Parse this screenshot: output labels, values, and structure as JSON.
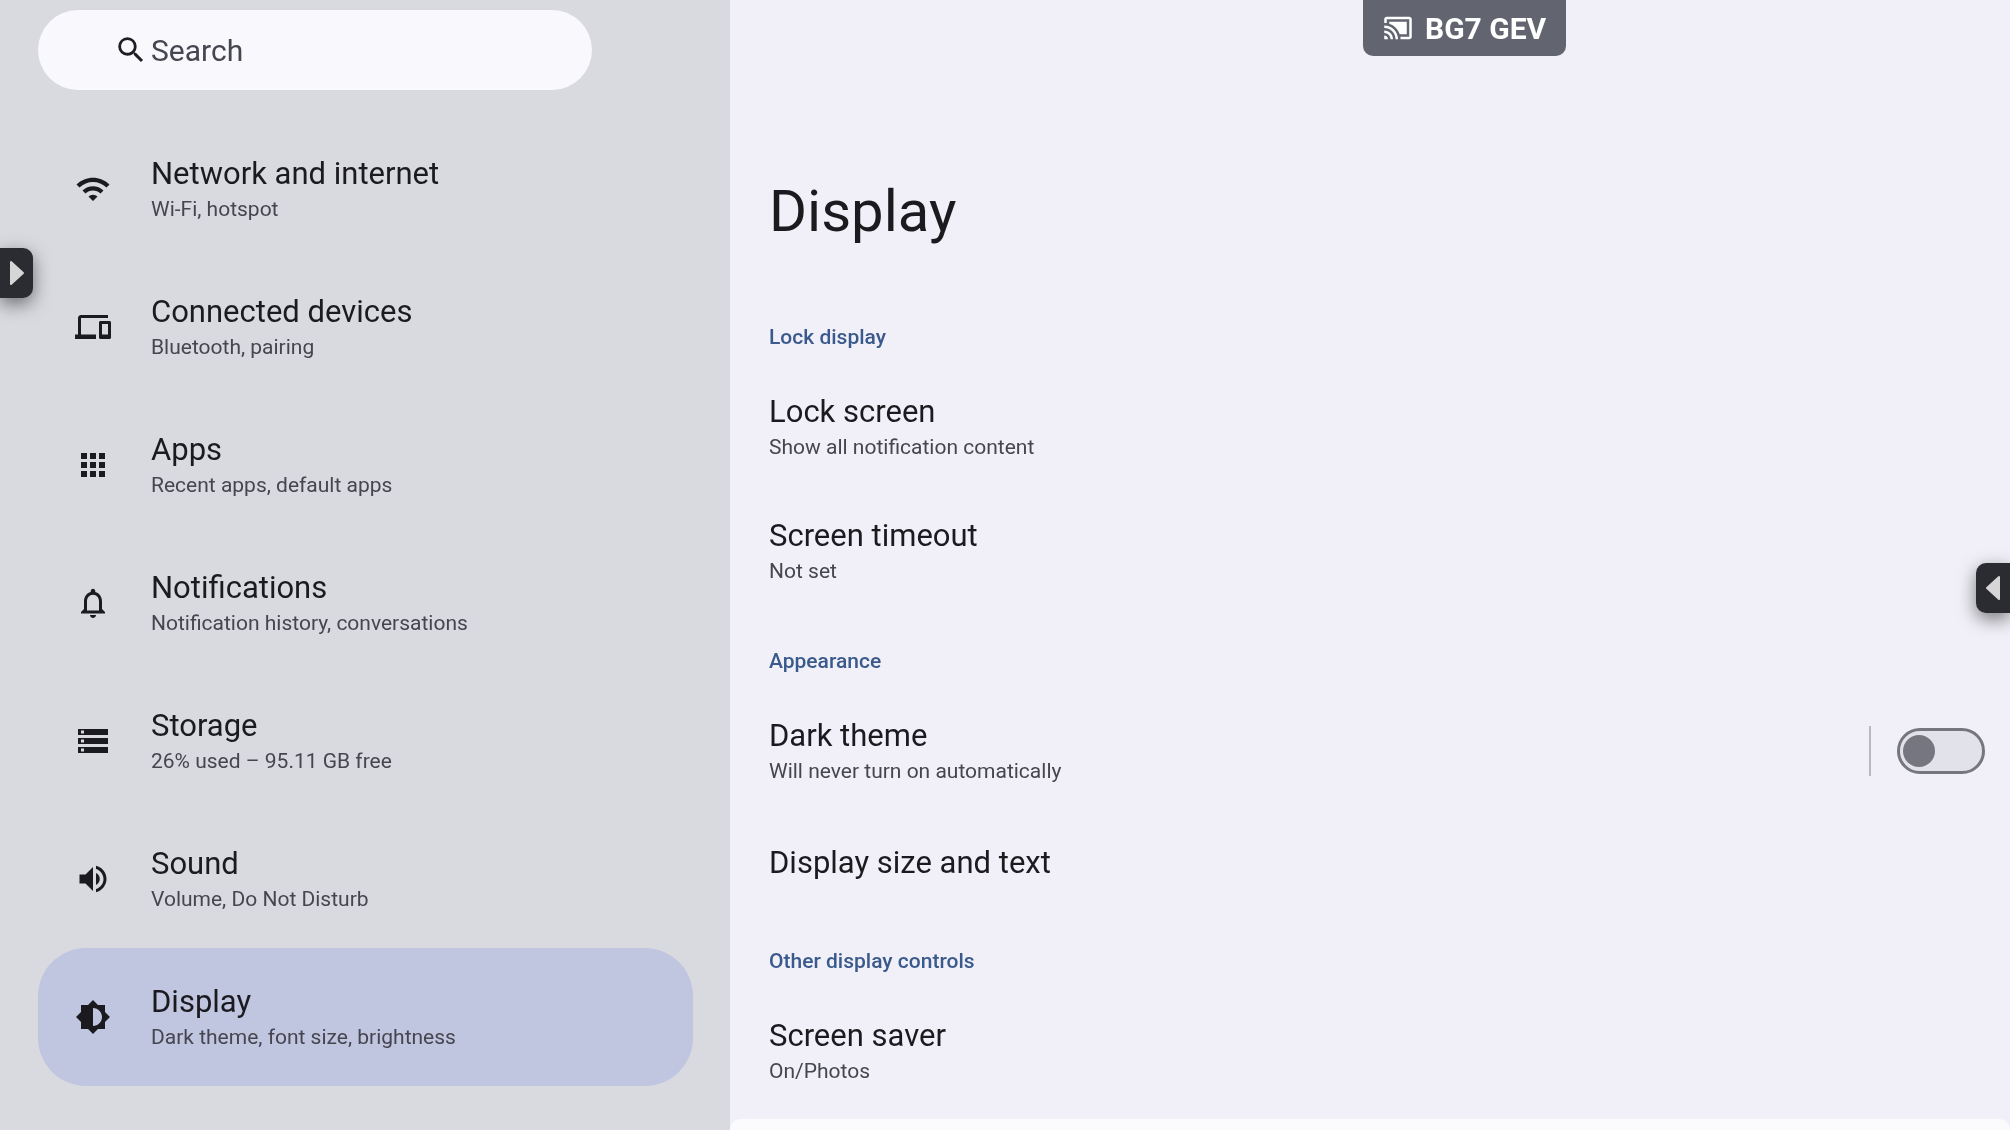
{
  "search": {
    "placeholder": "Search"
  },
  "sidebar": {
    "items": [
      {
        "title": "Network and internet",
        "subtitle": "Wi-Fi, hotspot",
        "selected": false
      },
      {
        "title": "Connected devices",
        "subtitle": "Bluetooth, pairing",
        "selected": false
      },
      {
        "title": "Apps",
        "subtitle": "Recent apps, default apps",
        "selected": false
      },
      {
        "title": "Notifications",
        "subtitle": "Notification history, conversations",
        "selected": false
      },
      {
        "title": "Storage",
        "subtitle": "26% used – 95.11 GB free",
        "selected": false
      },
      {
        "title": "Sound",
        "subtitle": "Volume, Do Not Disturb",
        "selected": false
      },
      {
        "title": "Display",
        "subtitle": "Dark theme, font size, brightness",
        "selected": true
      }
    ]
  },
  "badge": {
    "label": "BG7 GEV"
  },
  "page": {
    "title": "Display",
    "sections": [
      {
        "header": "Lock display",
        "items": [
          {
            "title": "Lock screen",
            "subtitle": "Show all notification content"
          },
          {
            "title": "Screen timeout",
            "subtitle": "Not set"
          }
        ]
      },
      {
        "header": "Appearance",
        "items": [
          {
            "title": "Dark theme",
            "subtitle": "Will never turn on automatically",
            "kind": "switch",
            "on": false
          },
          {
            "title": "Display size and text"
          }
        ]
      },
      {
        "header": "Other display controls",
        "items": [
          {
            "title": "Screen saver",
            "subtitle": "On/Photos"
          }
        ]
      }
    ]
  }
}
